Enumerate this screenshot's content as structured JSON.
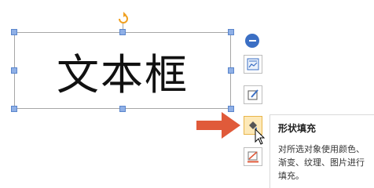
{
  "textbox": {
    "text": "文本框"
  },
  "toolbar": {
    "buttons": [
      {
        "name": "layout-options",
        "icon": "layout-options-icon"
      },
      {
        "name": "shape-style",
        "icon": "shape-style-icon"
      },
      {
        "name": "shape-fill",
        "icon": "paint-bucket-icon",
        "active": true
      },
      {
        "name": "shape-outline",
        "icon": "pen-outline-icon"
      }
    ]
  },
  "tooltip": {
    "title": "形状填充",
    "body": "对所选对象使用颜色、渐变、纹理、图片进行填充。"
  },
  "colors": {
    "handle": "#8fb0e6",
    "accent_blue": "#3b6fc4",
    "arrow": "#e05a3a",
    "rotate": "#f0a020",
    "active_button": "#fde9b8"
  }
}
